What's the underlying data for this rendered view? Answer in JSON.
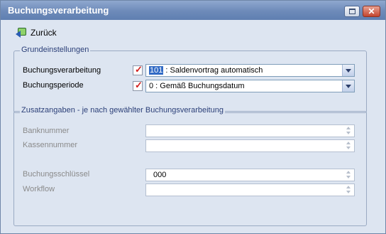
{
  "window": {
    "title": "Buchungsverarbeitung"
  },
  "toolbar": {
    "back_label": "Zurück",
    "back_icon": "back-arrow-icon"
  },
  "grundeinstellungen": {
    "legend": "Grundeinstellungen",
    "buchungsverarbeitung": {
      "label": "Buchungsverarbeitung",
      "value_code": "101",
      "value_text": " : Saldenvortrag automatisch"
    },
    "buchungsperiode": {
      "label": "Buchungsperiode",
      "value": "0 : Gemäß Buchungsdatum"
    }
  },
  "zusatzangaben": {
    "legend": "Zusatzangaben - je nach gewählter Buchungsverarbeitung",
    "banknummer": {
      "label": "Banknummer",
      "value": ""
    },
    "kassennummer": {
      "label": "Kassennummer",
      "value": ""
    },
    "buchungsschluessel": {
      "label": "Buchungsschlüssel",
      "value": "000"
    },
    "workflow": {
      "label": "Workflow",
      "value": ""
    }
  },
  "colors": {
    "titlebar": "#6d8ab9",
    "background": "#dde5f1",
    "selection": "#316ac5",
    "check_red": "#d11d1d"
  }
}
